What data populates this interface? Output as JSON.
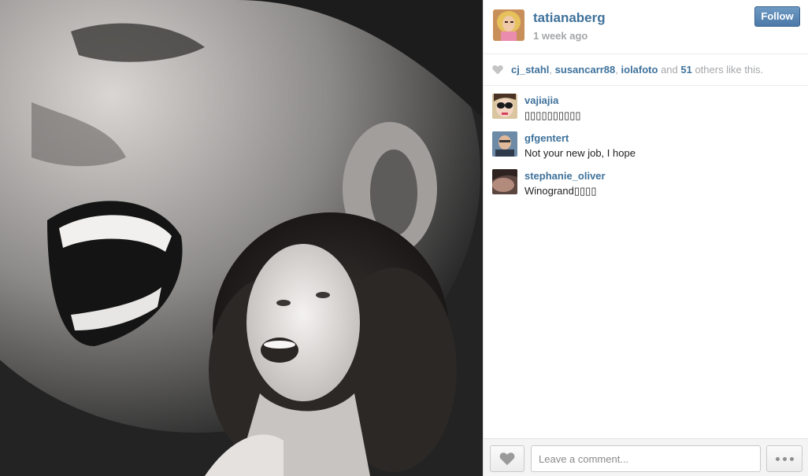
{
  "post": {
    "owner": "tatianaberg",
    "timestamp": "1 week ago",
    "follow_label": "Follow"
  },
  "likes": {
    "users": [
      "cj_stahl",
      "susancarr88",
      "iolafoto"
    ],
    "sep1": ", ",
    "sep2": ", ",
    "and_word": " and ",
    "others_count": "51",
    "others_suffix": " others like this."
  },
  "comments": [
    {
      "username": "vajiajia",
      "text": "▯▯▯▯▯▯▯▯▯▯"
    },
    {
      "username": "gfgentert",
      "text": "Not your new job, I hope"
    },
    {
      "username": "stephanie_oliver",
      "text": "Winogrand▯▯▯▯"
    }
  ],
  "footer": {
    "comment_placeholder": "Leave a comment..."
  },
  "icons": {
    "heart": "heart-icon",
    "more": "more-options-icon"
  },
  "colors": {
    "link": "#3f729b",
    "muted": "#a5a7aa",
    "follow_button": "#4d79a8"
  }
}
